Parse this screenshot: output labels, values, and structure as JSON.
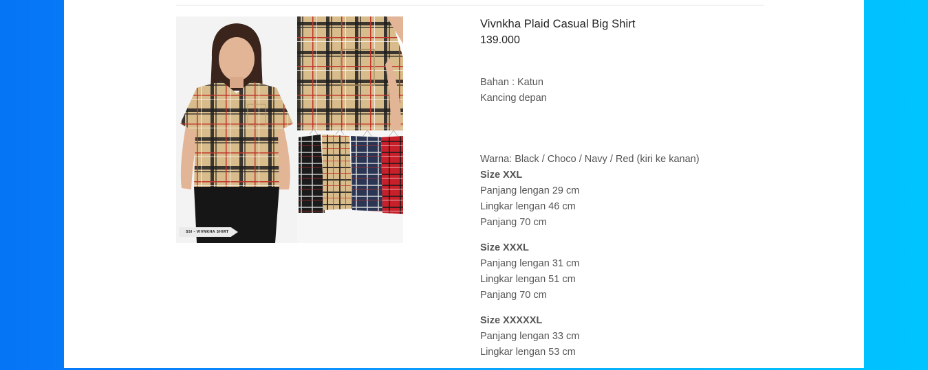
{
  "product": {
    "title": "Vivnkha Plaid Casual Big Shirt",
    "price": "139.000",
    "image": {
      "badge": "SSI - VIVNKHA SHIRT",
      "alt": "Vivnkha Plaid Casual Big Shirt"
    },
    "description": {
      "line1": "Bahan : Katun",
      "line2": "Kancing depan",
      "colors": "Warna: Black / Choco / Navy / Red (kiri ke kanan)"
    },
    "sizes": [
      {
        "name": "Size XXL",
        "lines": [
          "Panjang lengan 29 cm",
          "Lingkar lengan 46 cm",
          "Panjang 70 cm"
        ]
      },
      {
        "name": "Size XXXL",
        "lines": [
          "Panjang lengan 31 cm",
          "Lingkar lengan 51 cm",
          "Panjang 70 cm"
        ]
      },
      {
        "name": "Size XXXXXL",
        "lines": [
          "Panjang lengan 33 cm",
          "Lingkar lengan 53 cm"
        ]
      }
    ]
  },
  "colors": {
    "bg_left": "#0574f5",
    "bg_right": "#00c4ff",
    "plaid_base": "#d9bc8c",
    "plaid_dark": "#1e1e1e",
    "plaid_red": "#c0342b"
  }
}
